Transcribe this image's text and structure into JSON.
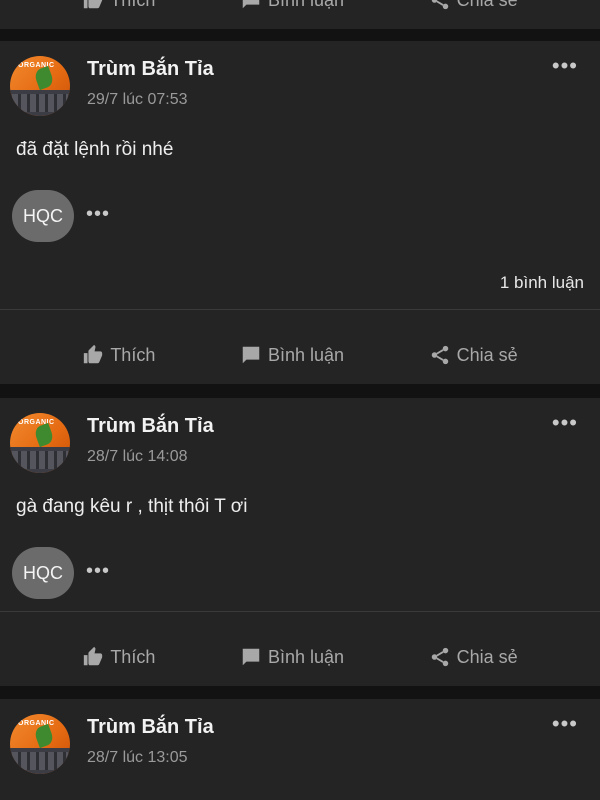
{
  "actions": {
    "like": "Thích",
    "comment": "Bình luận",
    "share": "Chia sẻ"
  },
  "posts": [
    {
      "author": "Trùm Bắn Tỉa",
      "time": "29/7 lúc 07:53",
      "text": "đã đặt lệnh rồi nhé",
      "reactor": "HQC",
      "comment_count": "1 bình luận"
    },
    {
      "author": "Trùm Bắn Tỉa",
      "time": "28/7 lúc 14:08",
      "text": "gà đang kêu r , thịt thôi T ơi",
      "reactor": "HQC"
    },
    {
      "author": "Trùm Bắn Tỉa",
      "time": "28/7 lúc 13:05"
    }
  ],
  "avatar_logo": "ORGANIC",
  "more_glyph": "•••"
}
